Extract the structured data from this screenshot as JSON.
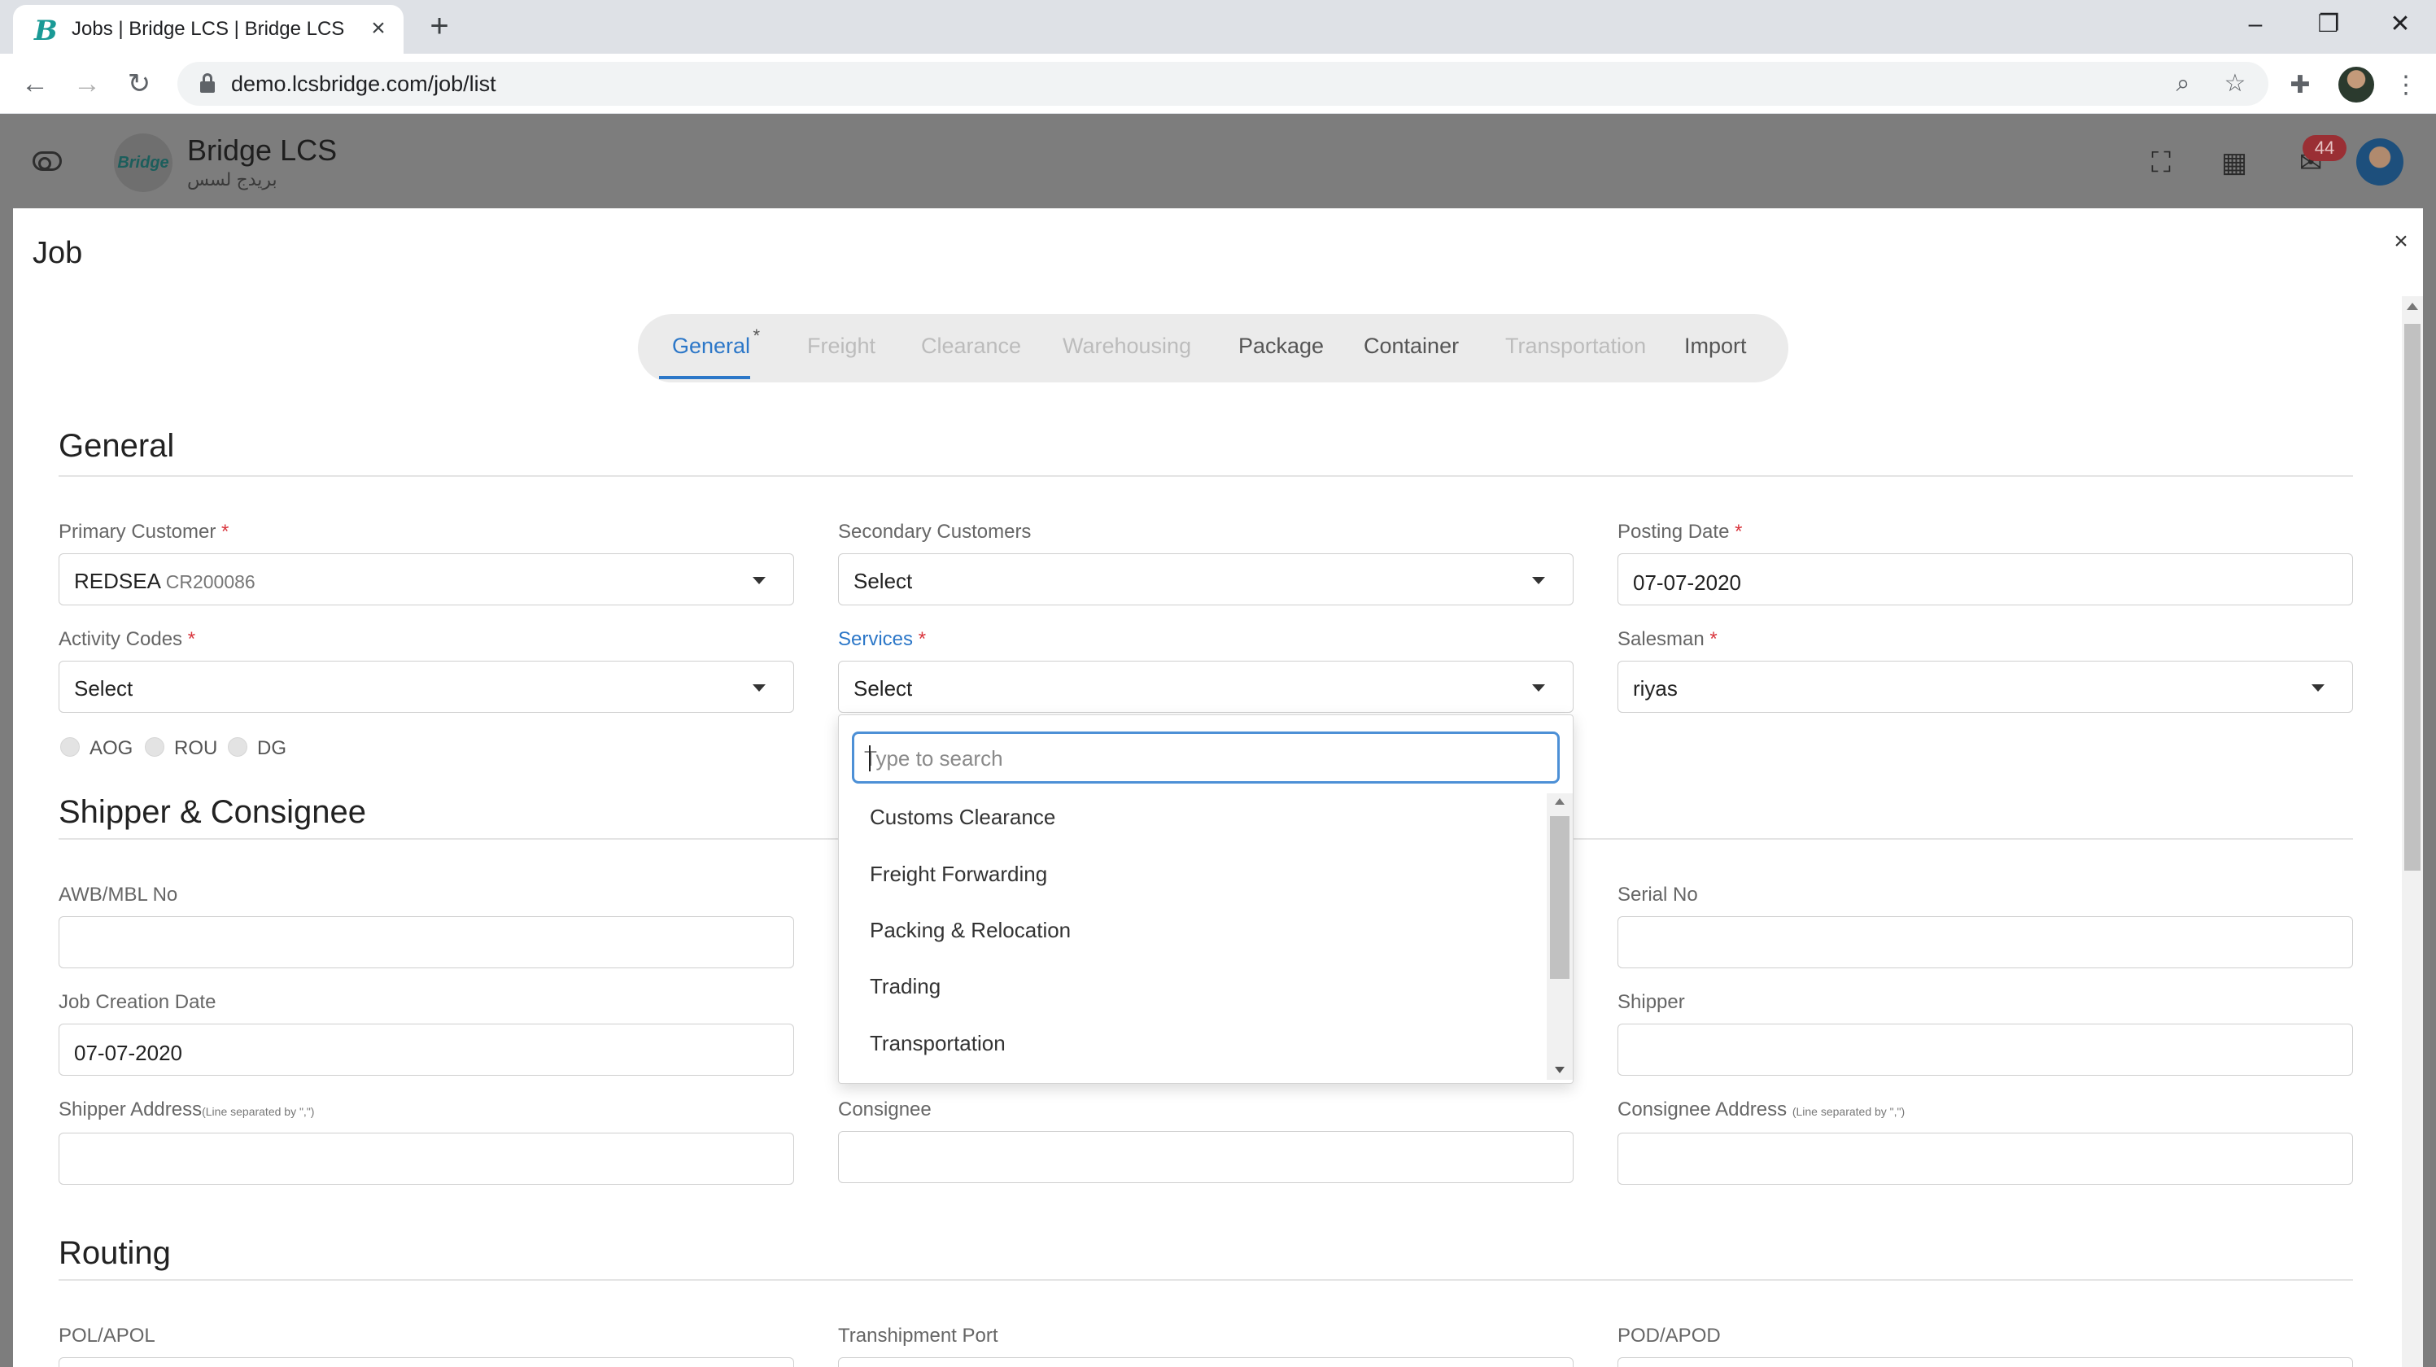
{
  "browser": {
    "tab_title": "Jobs | Bridge LCS | Bridge LCS",
    "tab_favicon": "B",
    "url": "demo.lcsbridge.com/job/list"
  },
  "app": {
    "brand": "Bridge LCS",
    "brand_arabic": "بريدج لسس",
    "logo_text": "Bridge",
    "notification_count": "44"
  },
  "modal": {
    "title": "Job",
    "close": "×"
  },
  "tabs": [
    {
      "label": "General",
      "state": "active"
    },
    {
      "label": "Freight",
      "state": "disabled"
    },
    {
      "label": "Clearance",
      "state": "disabled"
    },
    {
      "label": "Warehousing",
      "state": "disabled"
    },
    {
      "label": "Package",
      "state": "enabled"
    },
    {
      "label": "Container",
      "state": "enabled"
    },
    {
      "label": "Transportation",
      "state": "disabled"
    },
    {
      "label": "Import",
      "state": "enabled"
    }
  ],
  "tab_required_marker": "*",
  "required_marker": "*",
  "sections": {
    "general": "General",
    "shipper_consignee": "Shipper & Consignee",
    "routing": "Routing"
  },
  "general": {
    "primary_customer": {
      "label": "Primary Customer",
      "value": "REDSEA",
      "code": "CR200086"
    },
    "secondary_customers": {
      "label": "Secondary Customers",
      "value": "Select"
    },
    "posting_date": {
      "label": "Posting Date",
      "value": "07-07-2020"
    },
    "activity_codes": {
      "label": "Activity Codes",
      "value": "Select"
    },
    "services": {
      "label": "Services",
      "value": "Select"
    },
    "salesman": {
      "label": "Salesman",
      "value": "riyas"
    },
    "flags": [
      "AOG",
      "ROU",
      "DG"
    ]
  },
  "shipper": {
    "awb": {
      "label": "AWB/MBL No",
      "value": ""
    },
    "serial": {
      "label": "Serial No",
      "value": ""
    },
    "job_creation_date": {
      "label": "Job Creation Date",
      "value": "07-07-2020"
    },
    "shipper": {
      "label": "Shipper",
      "value": ""
    },
    "shipper_address": {
      "label": "Shipper Address",
      "hint": "(Line separated by \",\")",
      "value": ""
    },
    "consignee": {
      "label": "Consignee",
      "value": ""
    },
    "consignee_address": {
      "label": "Consignee Address",
      "hint": "(Line separated by \",\")",
      "value": ""
    }
  },
  "routing": {
    "pol": {
      "label": "POL/APOL"
    },
    "transhipment": {
      "label": "Transhipment Port"
    },
    "pod": {
      "label": "POD/APOD"
    }
  },
  "services_dropdown": {
    "search_placeholder": "Type to search",
    "options": [
      "Customs Clearance",
      "Freight Forwarding",
      "Packing & Relocation",
      "Trading",
      "Transportation"
    ]
  }
}
